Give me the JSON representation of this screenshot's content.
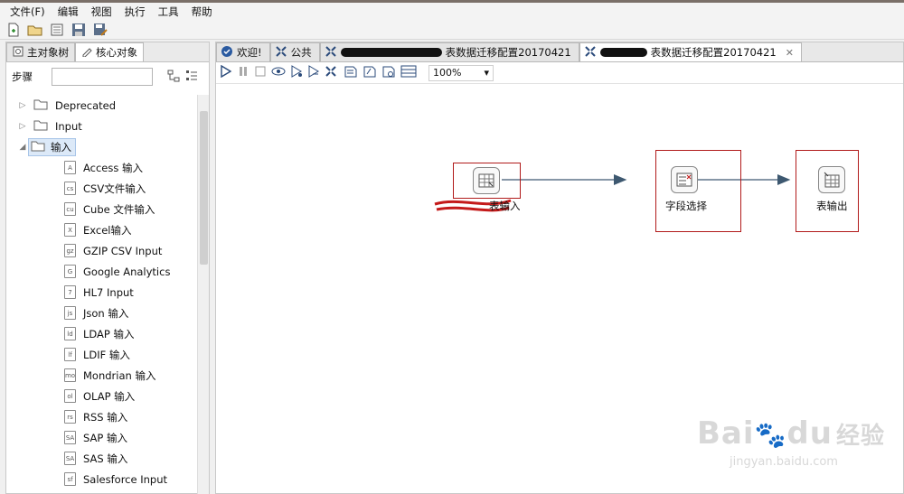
{
  "menu": [
    "文件(F)",
    "编辑",
    "视图",
    "执行",
    "工具",
    "帮助"
  ],
  "toolbar_icons": [
    "new-file-icon",
    "open-icon",
    "explore-icon",
    "save-icon",
    "save-as-icon"
  ],
  "left_tabs": [
    {
      "label": "主对象树",
      "icon": "tree-icon"
    },
    {
      "label": "核心对象",
      "icon": "pencil-icon"
    }
  ],
  "search": {
    "label": "步骤",
    "value": ""
  },
  "tree": {
    "folders": [
      {
        "label": "Deprecated",
        "expanded": false
      },
      {
        "label": "Input",
        "expanded": false
      },
      {
        "label": "输入",
        "expanded": true
      }
    ],
    "steps": [
      {
        "label": "Access 输入",
        "icon": "A"
      },
      {
        "label": "CSV文件输入",
        "icon": "csv"
      },
      {
        "label": "Cube 文件输入",
        "icon": "cube"
      },
      {
        "label": "Excel输入",
        "icon": "X"
      },
      {
        "label": "GZIP CSV Input",
        "icon": "gz"
      },
      {
        "label": "Google Analytics",
        "icon": "G"
      },
      {
        "label": "HL7 Input",
        "icon": "7"
      },
      {
        "label": "Json 输入",
        "icon": "js"
      },
      {
        "label": "LDAP 输入",
        "icon": "ld"
      },
      {
        "label": "LDIF 输入",
        "icon": "lf"
      },
      {
        "label": "Mondrian 输入",
        "icon": "mo"
      },
      {
        "label": "OLAP 输入",
        "icon": "ol"
      },
      {
        "label": "RSS 输入",
        "icon": "rss"
      },
      {
        "label": "SAP 输入",
        "icon": "SAP"
      },
      {
        "label": "SAS 输入",
        "icon": "SAS"
      },
      {
        "label": "Salesforce Input",
        "icon": "sf"
      }
    ]
  },
  "editor_tabs": [
    {
      "label": "欢迎!",
      "icon": "welcome-icon",
      "redacted": false,
      "active": false
    },
    {
      "label": "公共",
      "icon": "transform-icon",
      "redacted": false,
      "active": false
    },
    {
      "label": "表数据迁移配置20170421",
      "icon": "transform-icon",
      "redacted": true,
      "active": false
    },
    {
      "label": "表数据迁移配置20170421",
      "icon": "transform-icon",
      "redacted": true,
      "active": true
    }
  ],
  "zoom": "100%",
  "steps_canvas": [
    {
      "label": "表输入",
      "icon": "table-input-icon"
    },
    {
      "label": "字段选择",
      "icon": "select-values-icon"
    },
    {
      "label": "表输出",
      "icon": "table-output-icon"
    }
  ],
  "watermark": {
    "brand": "Bai",
    "brand2": "du",
    "brand_cn": "经验",
    "url": "jingyan.baidu.com"
  }
}
